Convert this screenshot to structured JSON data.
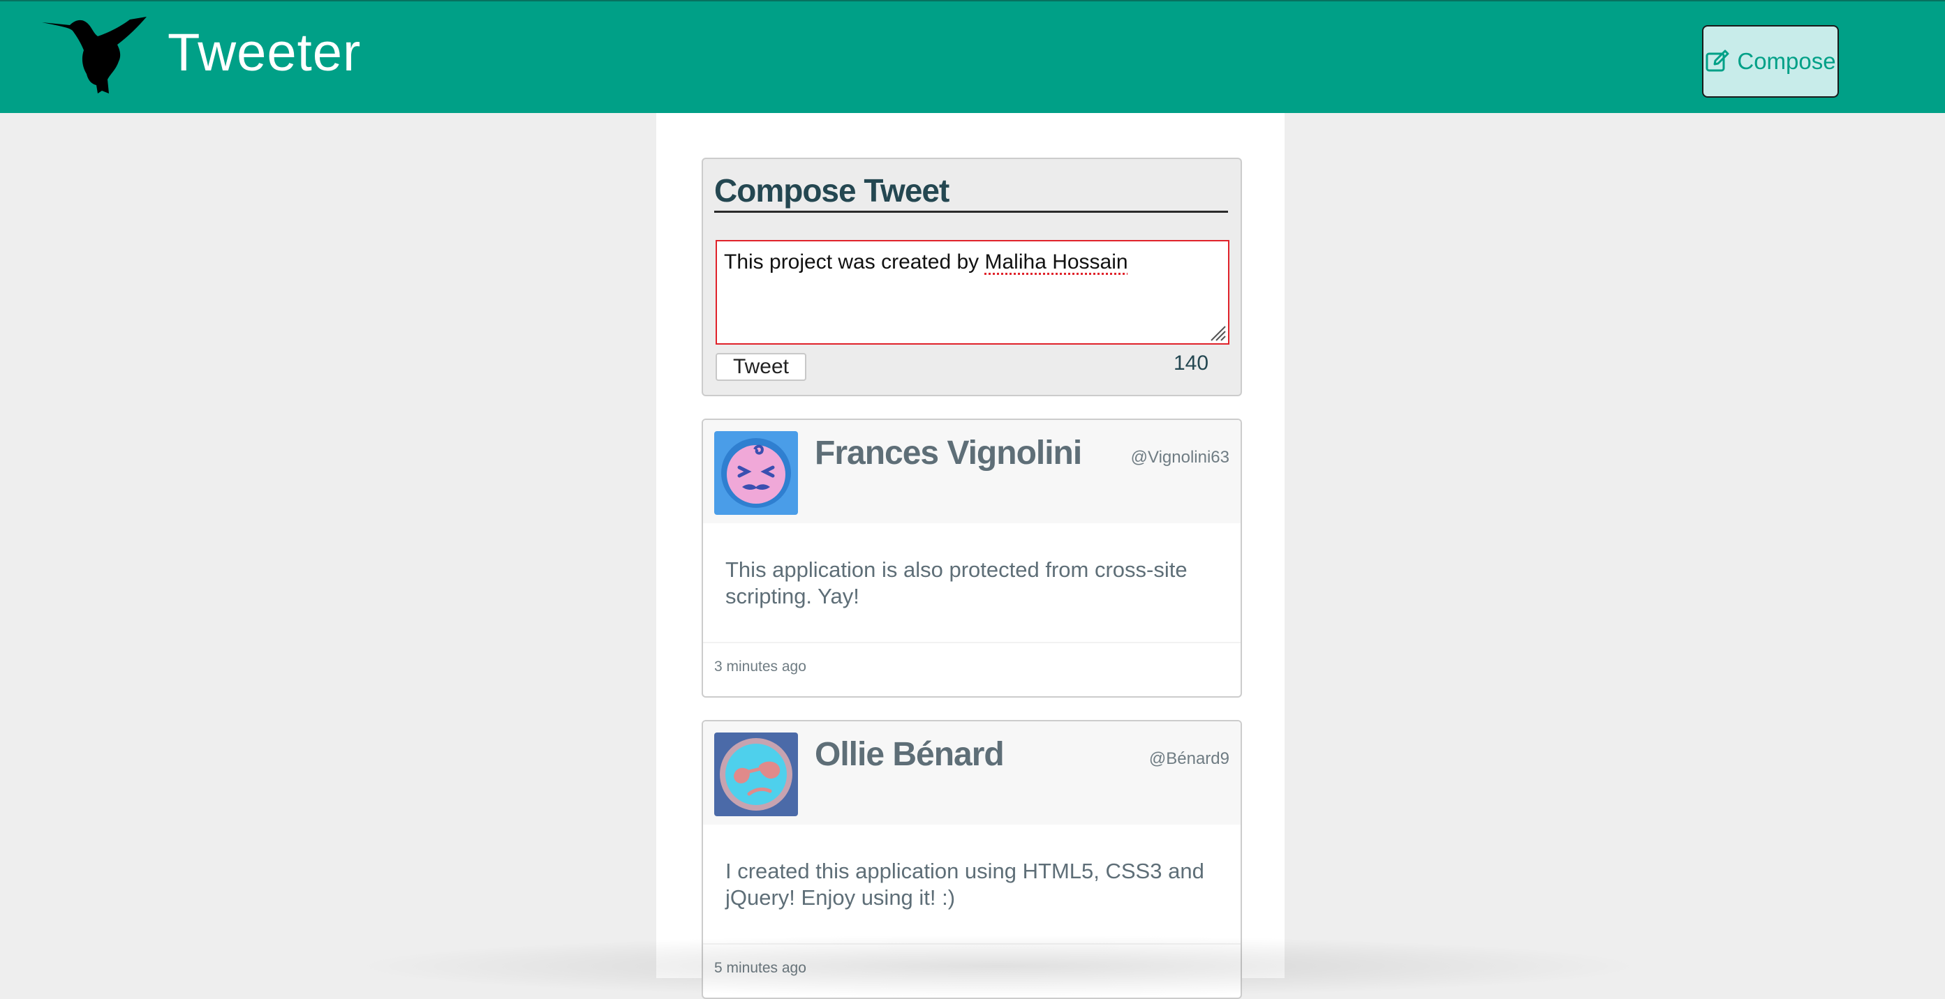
{
  "nav": {
    "brand": "Tweeter",
    "compose_label": "Compose",
    "logo_icon": "hummingbird-icon",
    "compose_icon": "edit-icon",
    "color": "#00a087"
  },
  "compose": {
    "title": "Compose Tweet",
    "text_before": "This project was created by ",
    "text_misspelled": "Maliha Hossain",
    "button_label": "Tweet",
    "counter": "140"
  },
  "tweets": [
    {
      "name": "Frances Vignolini",
      "handle": "@Vignolini63",
      "body": "This application is also protected from cross-site scripting. Yay!",
      "time": "3 minutes ago",
      "avatar_icon": "avatar-face-icon",
      "avatar_bg": "#4a9de8",
      "avatar_face": "#f0a8d8"
    },
    {
      "name": "Ollie Bénard",
      "handle": "@Bénard9",
      "body": "I created this application using HTML5, CSS3 and jQuery! Enjoy using it! :)",
      "time": "5 minutes ago",
      "avatar_icon": "avatar-sunglasses-icon",
      "avatar_bg": "#4b6aa8",
      "avatar_face": "#4ed0ec"
    }
  ]
}
